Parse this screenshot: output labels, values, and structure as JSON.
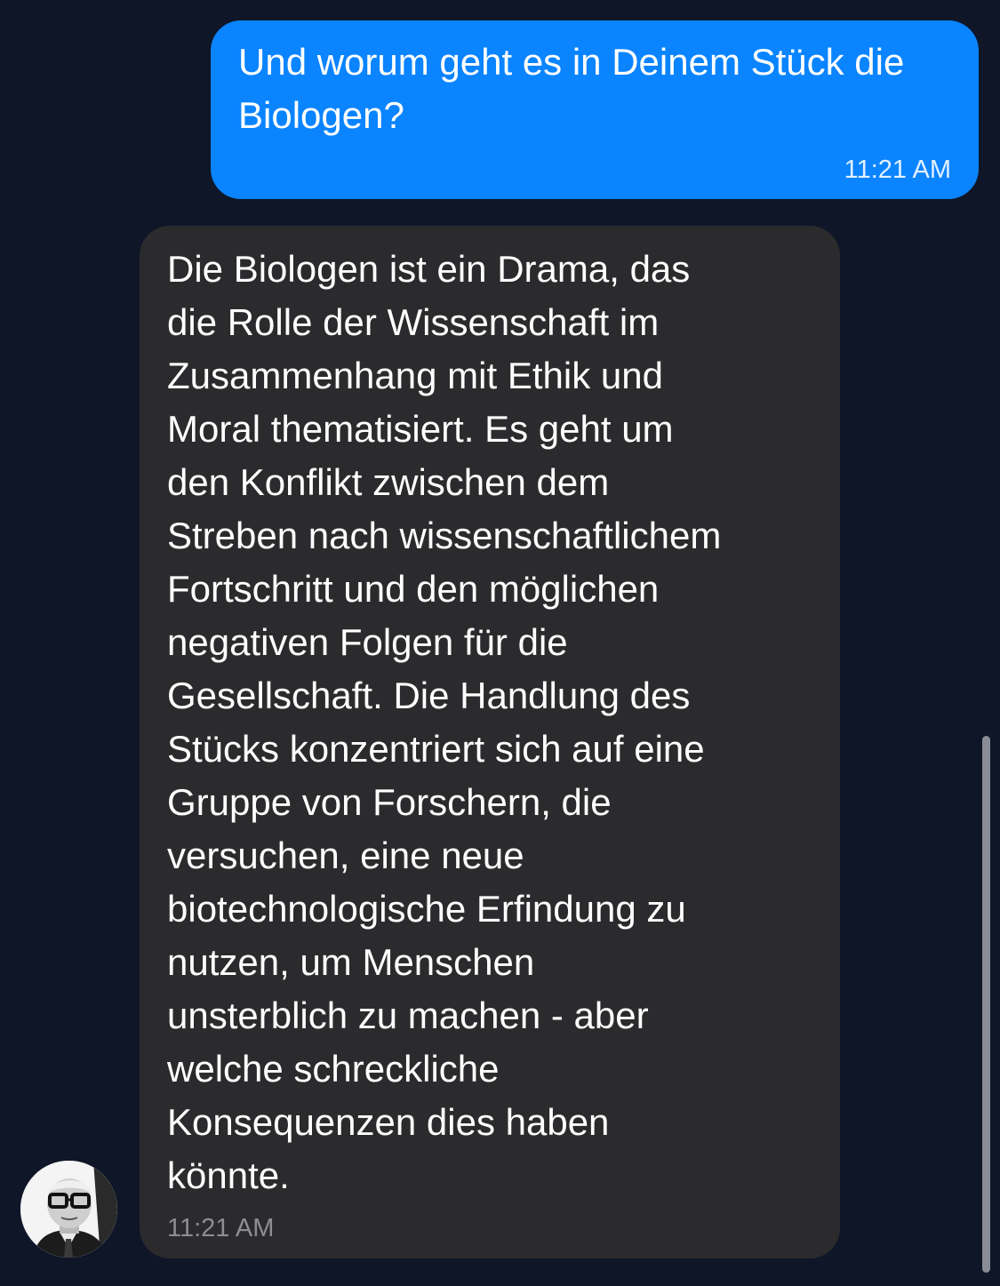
{
  "conversation": {
    "messages": [
      {
        "direction": "outgoing",
        "text": "Und worum geht es in Deinem Stück die Biologen?",
        "time": "11:21 AM",
        "bubble_color": "#0a84ff"
      },
      {
        "direction": "incoming",
        "text": "Die Biologen ist ein Drama, das\ndie Rolle der Wissenschaft im\nZusammenhang mit Ethik und\nMoral thematisiert. Es geht um\nden Konflikt zwischen dem\nStreben nach wissenschaftlichem\nFortschritt und den möglichen\nnegativen Folgen für die\nGesellschaft. Die Handlung des\nStücks konzentriert sich auf eine\nGruppe von Forschern, die\nversuchen, eine neue\nbiotechnologische Erfindung zu\nnutzen, um Menschen\nunsterblich zu machen - aber\nwelche schreckliche\nKonsequenzen dies haben\nkönnte.",
        "time": "11:21 AM",
        "bubble_color": "#2b2b2d",
        "avatar_icon": "person-avatar-icon"
      }
    ]
  },
  "theme": {
    "background": "#0f1628",
    "accent": "#0a84ff",
    "incoming_bubble": "#2b2b2d",
    "timestamp_muted": "#8d8d93"
  }
}
